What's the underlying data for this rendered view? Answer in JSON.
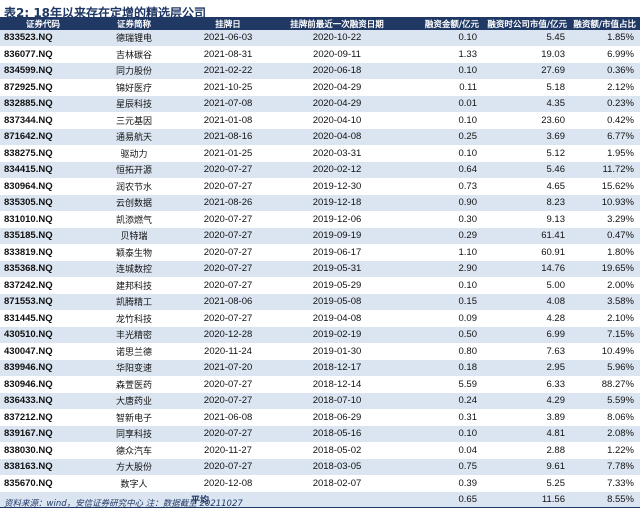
{
  "title": "表2: 18年以来存在定增的精选层公司",
  "columns": [
    "证券代码",
    "证券简称",
    "挂牌日",
    "挂牌前最近一次融资日期",
    "融资金额/亿元",
    "融资时公司市值/亿元",
    "融资额/市值占比"
  ],
  "rows": [
    [
      "833523.NQ",
      "德瑞锂电",
      "2021-06-03",
      "2020-10-22",
      "0.10",
      "5.45",
      "1.85%"
    ],
    [
      "836077.NQ",
      "吉林碳谷",
      "2021-08-31",
      "2020-09-11",
      "1.33",
      "19.03",
      "6.99%"
    ],
    [
      "834599.NQ",
      "同力股份",
      "2021-02-22",
      "2020-06-18",
      "0.10",
      "27.69",
      "0.36%"
    ],
    [
      "872925.NQ",
      "锦好医疗",
      "2021-10-25",
      "2020-04-29",
      "0.11",
      "5.18",
      "2.12%"
    ],
    [
      "832885.NQ",
      "星辰科技",
      "2021-07-08",
      "2020-04-29",
      "0.01",
      "4.35",
      "0.23%"
    ],
    [
      "837344.NQ",
      "三元基因",
      "2021-01-08",
      "2020-04-10",
      "0.10",
      "23.60",
      "0.42%"
    ],
    [
      "871642.NQ",
      "通易航天",
      "2021-08-16",
      "2020-04-08",
      "0.25",
      "3.69",
      "6.77%"
    ],
    [
      "838275.NQ",
      "驱动力",
      "2021-01-25",
      "2020-03-31",
      "0.10",
      "5.12",
      "1.95%"
    ],
    [
      "834415.NQ",
      "恒拓开源",
      "2020-07-27",
      "2020-02-12",
      "0.64",
      "5.46",
      "11.72%"
    ],
    [
      "830964.NQ",
      "润农节水",
      "2020-07-27",
      "2019-12-30",
      "0.73",
      "4.65",
      "15.62%"
    ],
    [
      "835305.NQ",
      "云创数据",
      "2021-08-26",
      "2019-12-18",
      "0.90",
      "8.23",
      "10.93%"
    ],
    [
      "831010.NQ",
      "凯添燃气",
      "2020-07-27",
      "2019-12-06",
      "0.30",
      "9.13",
      "3.29%"
    ],
    [
      "835185.NQ",
      "贝特瑞",
      "2020-07-27",
      "2019-09-19",
      "0.29",
      "61.41",
      "0.47%"
    ],
    [
      "833819.NQ",
      "颖泰生物",
      "2020-07-27",
      "2019-06-17",
      "1.10",
      "60.91",
      "1.80%"
    ],
    [
      "835368.NQ",
      "连城数控",
      "2020-07-27",
      "2019-05-31",
      "2.90",
      "14.76",
      "19.65%"
    ],
    [
      "837242.NQ",
      "建邦科技",
      "2020-07-27",
      "2019-05-29",
      "0.10",
      "5.00",
      "2.00%"
    ],
    [
      "871553.NQ",
      "凯腾精工",
      "2021-08-06",
      "2019-05-08",
      "0.15",
      "4.08",
      "3.58%"
    ],
    [
      "831445.NQ",
      "龙竹科技",
      "2020-07-27",
      "2019-04-08",
      "0.09",
      "4.28",
      "2.10%"
    ],
    [
      "430510.NQ",
      "丰光精密",
      "2020-12-28",
      "2019-02-19",
      "0.50",
      "6.99",
      "7.15%"
    ],
    [
      "430047.NQ",
      "诺思兰德",
      "2020-11-24",
      "2019-01-30",
      "0.80",
      "7.63",
      "10.49%"
    ],
    [
      "839946.NQ",
      "华阳变速",
      "2021-07-20",
      "2018-12-17",
      "0.18",
      "2.95",
      "5.96%"
    ],
    [
      "830946.NQ",
      "森萱医药",
      "2020-07-27",
      "2018-12-14",
      "5.59",
      "6.33",
      "88.27%"
    ],
    [
      "836433.NQ",
      "大唐药业",
      "2020-07-27",
      "2018-07-10",
      "0.24",
      "4.29",
      "5.59%"
    ],
    [
      "837212.NQ",
      "智新电子",
      "2021-06-08",
      "2018-06-29",
      "0.31",
      "3.89",
      "8.06%"
    ],
    [
      "839167.NQ",
      "同享科技",
      "2020-07-27",
      "2018-05-16",
      "0.10",
      "4.81",
      "2.08%"
    ],
    [
      "838030.NQ",
      "德众汽车",
      "2020-11-27",
      "2018-05-02",
      "0.04",
      "2.88",
      "1.22%"
    ],
    [
      "838163.NQ",
      "方大股份",
      "2020-07-27",
      "2018-03-05",
      "0.75",
      "9.61",
      "7.78%"
    ],
    [
      "835670.NQ",
      "数字人",
      "2020-12-08",
      "2018-02-07",
      "0.39",
      "5.25",
      "7.33%"
    ]
  ],
  "average": {
    "label": "平均",
    "amount": "0.65",
    "market_cap": "11.56",
    "ratio": "8.55%"
  },
  "source": "资料来源：wind，安信证券研究中心    注：数据截至 20211027"
}
